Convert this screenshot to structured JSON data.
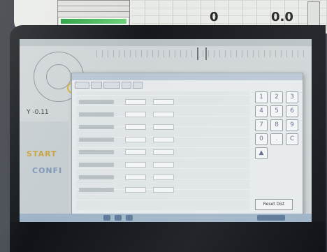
{
  "photo": {
    "top_display": {
      "value_left": "0",
      "value_right": "0.0"
    },
    "screen": {
      "coord_readout": "Y -0.11",
      "start_label": "START",
      "config_label": "CONFI",
      "dialog": {
        "keypad_keys": [
          "1",
          "2",
          "3",
          "4",
          "5",
          "6",
          "7",
          "8",
          "9",
          "0",
          ".",
          "C",
          "▲"
        ],
        "reset_label": "Reset Dist"
      }
    }
  }
}
